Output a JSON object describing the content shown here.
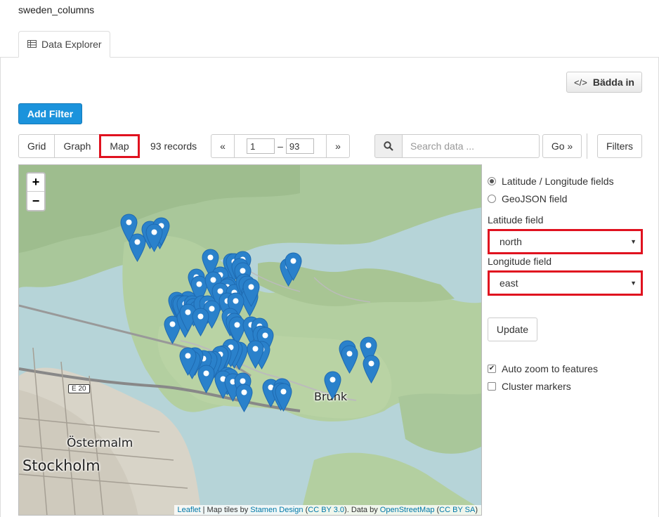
{
  "page_title": "sweden_columns",
  "tab": {
    "label": "Data Explorer",
    "icon": "table-icon"
  },
  "toolbar": {
    "embed_label": "Bädda in",
    "add_filter_label": "Add Filter",
    "views": [
      {
        "label": "Grid"
      },
      {
        "label": "Graph"
      },
      {
        "label": "Map",
        "active": true
      }
    ],
    "records": "93 records",
    "pager": {
      "prev": "«",
      "from": "1",
      "dash": "–",
      "to": "93",
      "next": "»"
    },
    "search": {
      "placeholder": "Search data ..."
    },
    "go_label": "Go »",
    "filters_label": "Filters"
  },
  "map": {
    "zoom_in": "+",
    "zoom_out": "−",
    "labels": {
      "ostermalm": "Östermalm",
      "stockholm": "Stockholm",
      "brunk": "Brunk",
      "road": "E 20"
    },
    "attribution": {
      "leaflet": "Leaflet",
      "map_tiles_by": " | Map tiles by ",
      "stamen": "Stamen Design",
      "ccby3": "CC BY 3.0",
      "data_by": ". Data by ",
      "osm": "OpenStreetMap",
      "ccbysa": "CC BY SA"
    },
    "marker_color": "#2a81cb",
    "marker_count": 93
  },
  "panel": {
    "mode_options": [
      {
        "label": "Latitude / Longitude fields",
        "selected": true
      },
      {
        "label": "GeoJSON field",
        "selected": false
      }
    ],
    "latitude_label": "Latitude field",
    "latitude_value": "north",
    "longitude_label": "Longitude field",
    "longitude_value": "east",
    "update_label": "Update",
    "auto_zoom_label": "Auto zoom to features",
    "auto_zoom_checked": true,
    "cluster_label": "Cluster markers",
    "cluster_checked": false
  },
  "colors": {
    "primary": "#1b93dc",
    "highlight": "#e0121f",
    "link": "#0078a8"
  }
}
